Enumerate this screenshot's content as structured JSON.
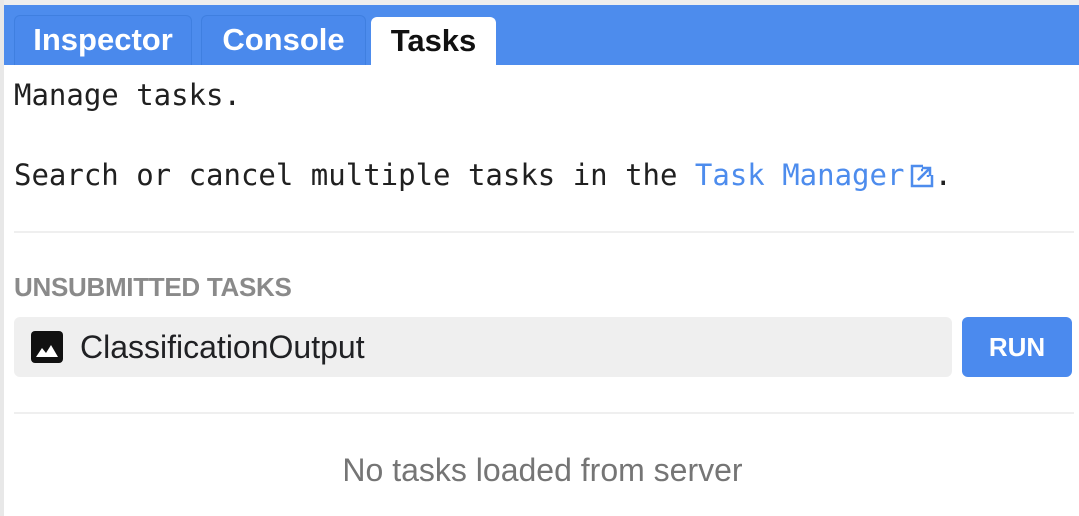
{
  "tabs": [
    {
      "label": "Inspector",
      "active": false
    },
    {
      "label": "Console",
      "active": false
    },
    {
      "label": "Tasks",
      "active": true
    }
  ],
  "intro": {
    "line1": "Manage tasks.",
    "line2_prefix": "Search or cancel multiple tasks in the ",
    "link_label": "Task Manager",
    "link_icon": "open-in-new-icon",
    "line2_suffix": "."
  },
  "unsubmitted": {
    "title": "UNSUBMITTED TASKS",
    "tasks": [
      {
        "name": "ClassificationOutput",
        "icon": "image-icon",
        "action_label": "RUN"
      }
    ]
  },
  "server": {
    "empty_message": "No tasks loaded from server"
  },
  "colors": {
    "accent": "#4d8ced",
    "section_title": "#8a8a8a",
    "task_row_bg": "#efefef"
  }
}
